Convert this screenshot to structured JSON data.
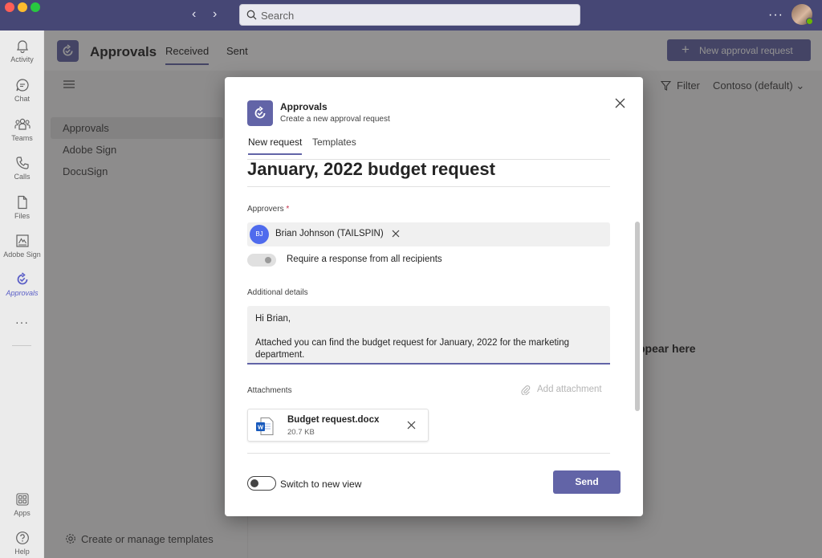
{
  "titlebar": {
    "search_placeholder": "Search",
    "more_label": "···"
  },
  "rail": {
    "items": [
      {
        "label": "Activity"
      },
      {
        "label": "Chat"
      },
      {
        "label": "Teams"
      },
      {
        "label": "Calls"
      },
      {
        "label": "Files"
      },
      {
        "label": "Adobe Sign"
      },
      {
        "label": "Approvals"
      }
    ],
    "more_label": "···",
    "apps_label": "Apps",
    "help_label": "Help"
  },
  "app": {
    "title": "Approvals",
    "tabs": [
      {
        "label": "Received"
      },
      {
        "label": "Sent"
      }
    ],
    "new_request_label": "New approval request",
    "filter_label": "Filter",
    "org_label": "Contoso (default)",
    "side_items": [
      {
        "label": "Approvals"
      },
      {
        "label": "Adobe Sign"
      },
      {
        "label": "DocuSign"
      }
    ],
    "empty_text": "ppear here",
    "manage_templates_label": "Create or manage templates"
  },
  "dialog": {
    "title": "Approvals",
    "subtitle": "Create a new approval request",
    "tabs": [
      {
        "label": "New request"
      },
      {
        "label": "Templates"
      }
    ],
    "request_title": "January, 2022 budget request",
    "approvers_label": "Approvers",
    "required_marker": "*",
    "approver": {
      "initials": "BJ",
      "name": "Brian Johnson (TAILSPIN)"
    },
    "require_all_label": "Require a response from all recipients",
    "details_label": "Additional details",
    "details_line1": "Hi Brian,",
    "details_line2": "Attached you can find the budget request for January, 2022 for the marketing department.",
    "attachments_label": "Attachments",
    "add_attachment_label": "Add attachment",
    "file": {
      "name": "Budget request.docx",
      "size": "20.7 KB"
    },
    "switch_view_label": "Switch to new view",
    "send_label": "Send"
  },
  "colors": {
    "titlebar": "#464775",
    "accent": "#6264a7",
    "avatar_bj": "#4f6bed",
    "required": "#c4314b"
  }
}
